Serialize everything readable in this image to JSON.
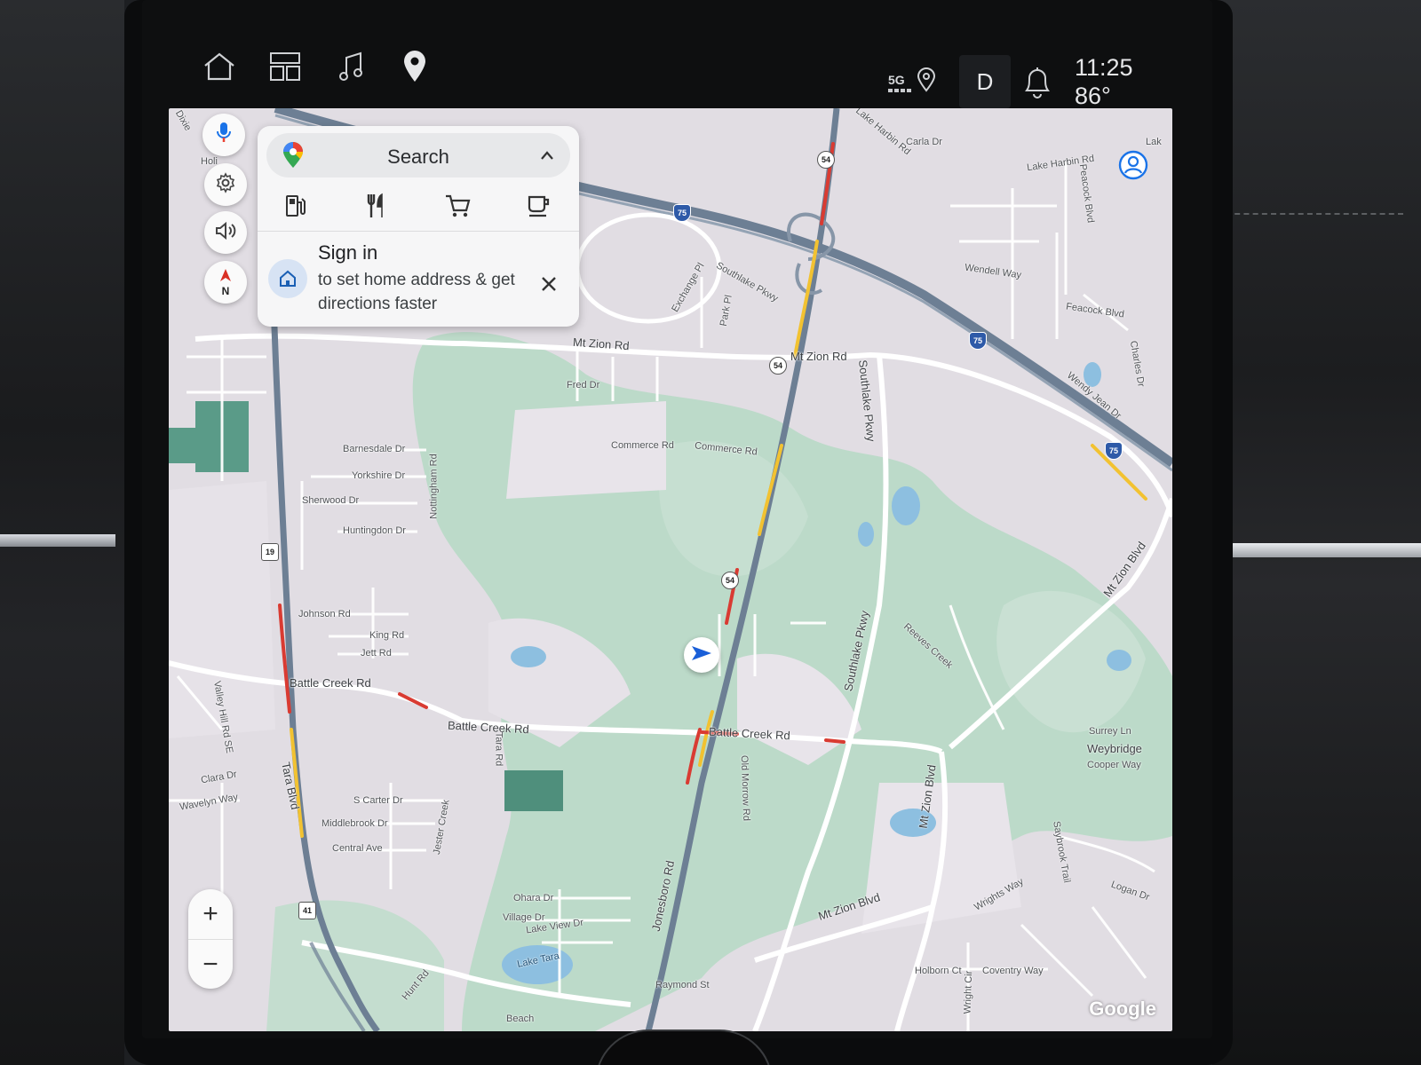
{
  "status_bar": {
    "nav": [
      {
        "name": "home-icon"
      },
      {
        "name": "apps-grid-icon"
      },
      {
        "name": "music-note-icon"
      },
      {
        "name": "map-pin-icon"
      }
    ],
    "network": "5G",
    "location_icon": "location-pin-icon",
    "gear": "D",
    "notification_icon": "bell-icon",
    "time": "11:25",
    "temperature": "86°"
  },
  "map_controls": {
    "mic_icon": "microphone-icon",
    "settings_icon": "gear-icon",
    "volume_icon": "volume-icon",
    "compass_label": "N",
    "zoom_in": "+",
    "zoom_out": "−"
  },
  "search_card": {
    "search_label": "Search",
    "categories": [
      {
        "name": "gas-station-icon"
      },
      {
        "name": "restaurant-icon"
      },
      {
        "name": "shopping-cart-icon"
      },
      {
        "name": "coffee-icon"
      }
    ],
    "signin_title": "Sign in",
    "signin_body": "to set home address & get directions faster"
  },
  "map": {
    "attribution": "Google",
    "colors": {
      "land": "#e1dde3",
      "park": "#b9d8c7",
      "water": "#8dbfe0",
      "highway": "#6d7f94",
      "traffic_slow": "#f2c231",
      "traffic_jam": "#d93b32",
      "road": "#ffffff"
    },
    "labels": {
      "mt_zion_rd": "Mt Zion Rd",
      "mt_zion_rd_2": "Mt Zion Rd",
      "fred_dr": "Fred Dr",
      "commerce_rd": "Commerce Rd",
      "commerce_rd_2": "Commerce Rd",
      "barnesdale": "Barnesdale Dr",
      "yorkshire": "Yorkshire Dr",
      "sherwood": "Sherwood Dr",
      "huntingdon": "Huntingdon Dr",
      "nottingham": "Nottingham Rd",
      "johnson": "Johnson Rd",
      "king": "King Rd",
      "jett": "Jett Rd",
      "battle_creek_1": "Battle Creek Rd",
      "battle_creek_2": "Battle Creek Rd",
      "battle_creek_3": "Battle Creek Rd",
      "valley_hill": "Valley Hill Rd SE",
      "clara": "Clara Dr",
      "wavelyn": "Wavelyn Way",
      "tara_blvd": "Tara Blvd",
      "tara_rd": "Tara Rd",
      "s_carter": "S Carter Dr",
      "middlebrook": "Middlebrook Dr",
      "central": "Central Ave",
      "jester_creek": "Jester Creek",
      "ohara": "Ohara Dr",
      "village": "Village Dr",
      "lake_view": "Lake View Dr",
      "lake_tara": "Lake Tara",
      "hunt_rd": "Hunt Rd",
      "beach": "Beach",
      "raymond": "Raymond St",
      "jonesboro": "Jonesboro Rd",
      "old_morrow": "Old Morrow Rd",
      "southlake_pkwy": "Southlake Pkwy",
      "southlake_pkwy_2": "Southlake Pkwy",
      "southlake_pkwy_3": "Southlake Pkwy",
      "reeves_creek": "Reeves Creek",
      "mt_zion_blvd": "Mt Zion Blvd",
      "mt_zion_blvd_2": "Mt Zion Blvd",
      "mt_zion_blvd_3": "Mt Zion Blvd",
      "surrey": "Surrey Ln",
      "weybridge": "Weybridge",
      "cooper": "Cooper Way",
      "saybrook": "Saybrook Trail",
      "wrights": "Wrights Way",
      "logan": "Logan Dr",
      "holborn": "Holborn Ct",
      "coventry": "Coventry Way",
      "wright_cir": "Wright Cir",
      "lake_harbin": "Lake Harbin Rd",
      "lake_harbin_2": "Lake Harbin Rd",
      "carla": "Carla Dr",
      "peacock_blvd": "Peacock Blvd",
      "wendell": "Wendell Way",
      "feacock_blvd": "Feacock Blvd",
      "charles": "Charles Dr",
      "wendy_jean": "Wendy Jean Dr",
      "exchange": "Exchange Pl",
      "park_pl": "Park Pl",
      "southlake_pkwy_top": "Southlake Pkwy",
      "dixie": "Dixie",
      "holi": "Holi",
      "lak": "Lak"
    },
    "shields": {
      "i75_a": "75",
      "i75_b": "75",
      "i75_c": "75",
      "sr54_a": "54",
      "sr54_b": "54",
      "sr54_c": "54",
      "us19": "19",
      "us41": "41"
    }
  }
}
